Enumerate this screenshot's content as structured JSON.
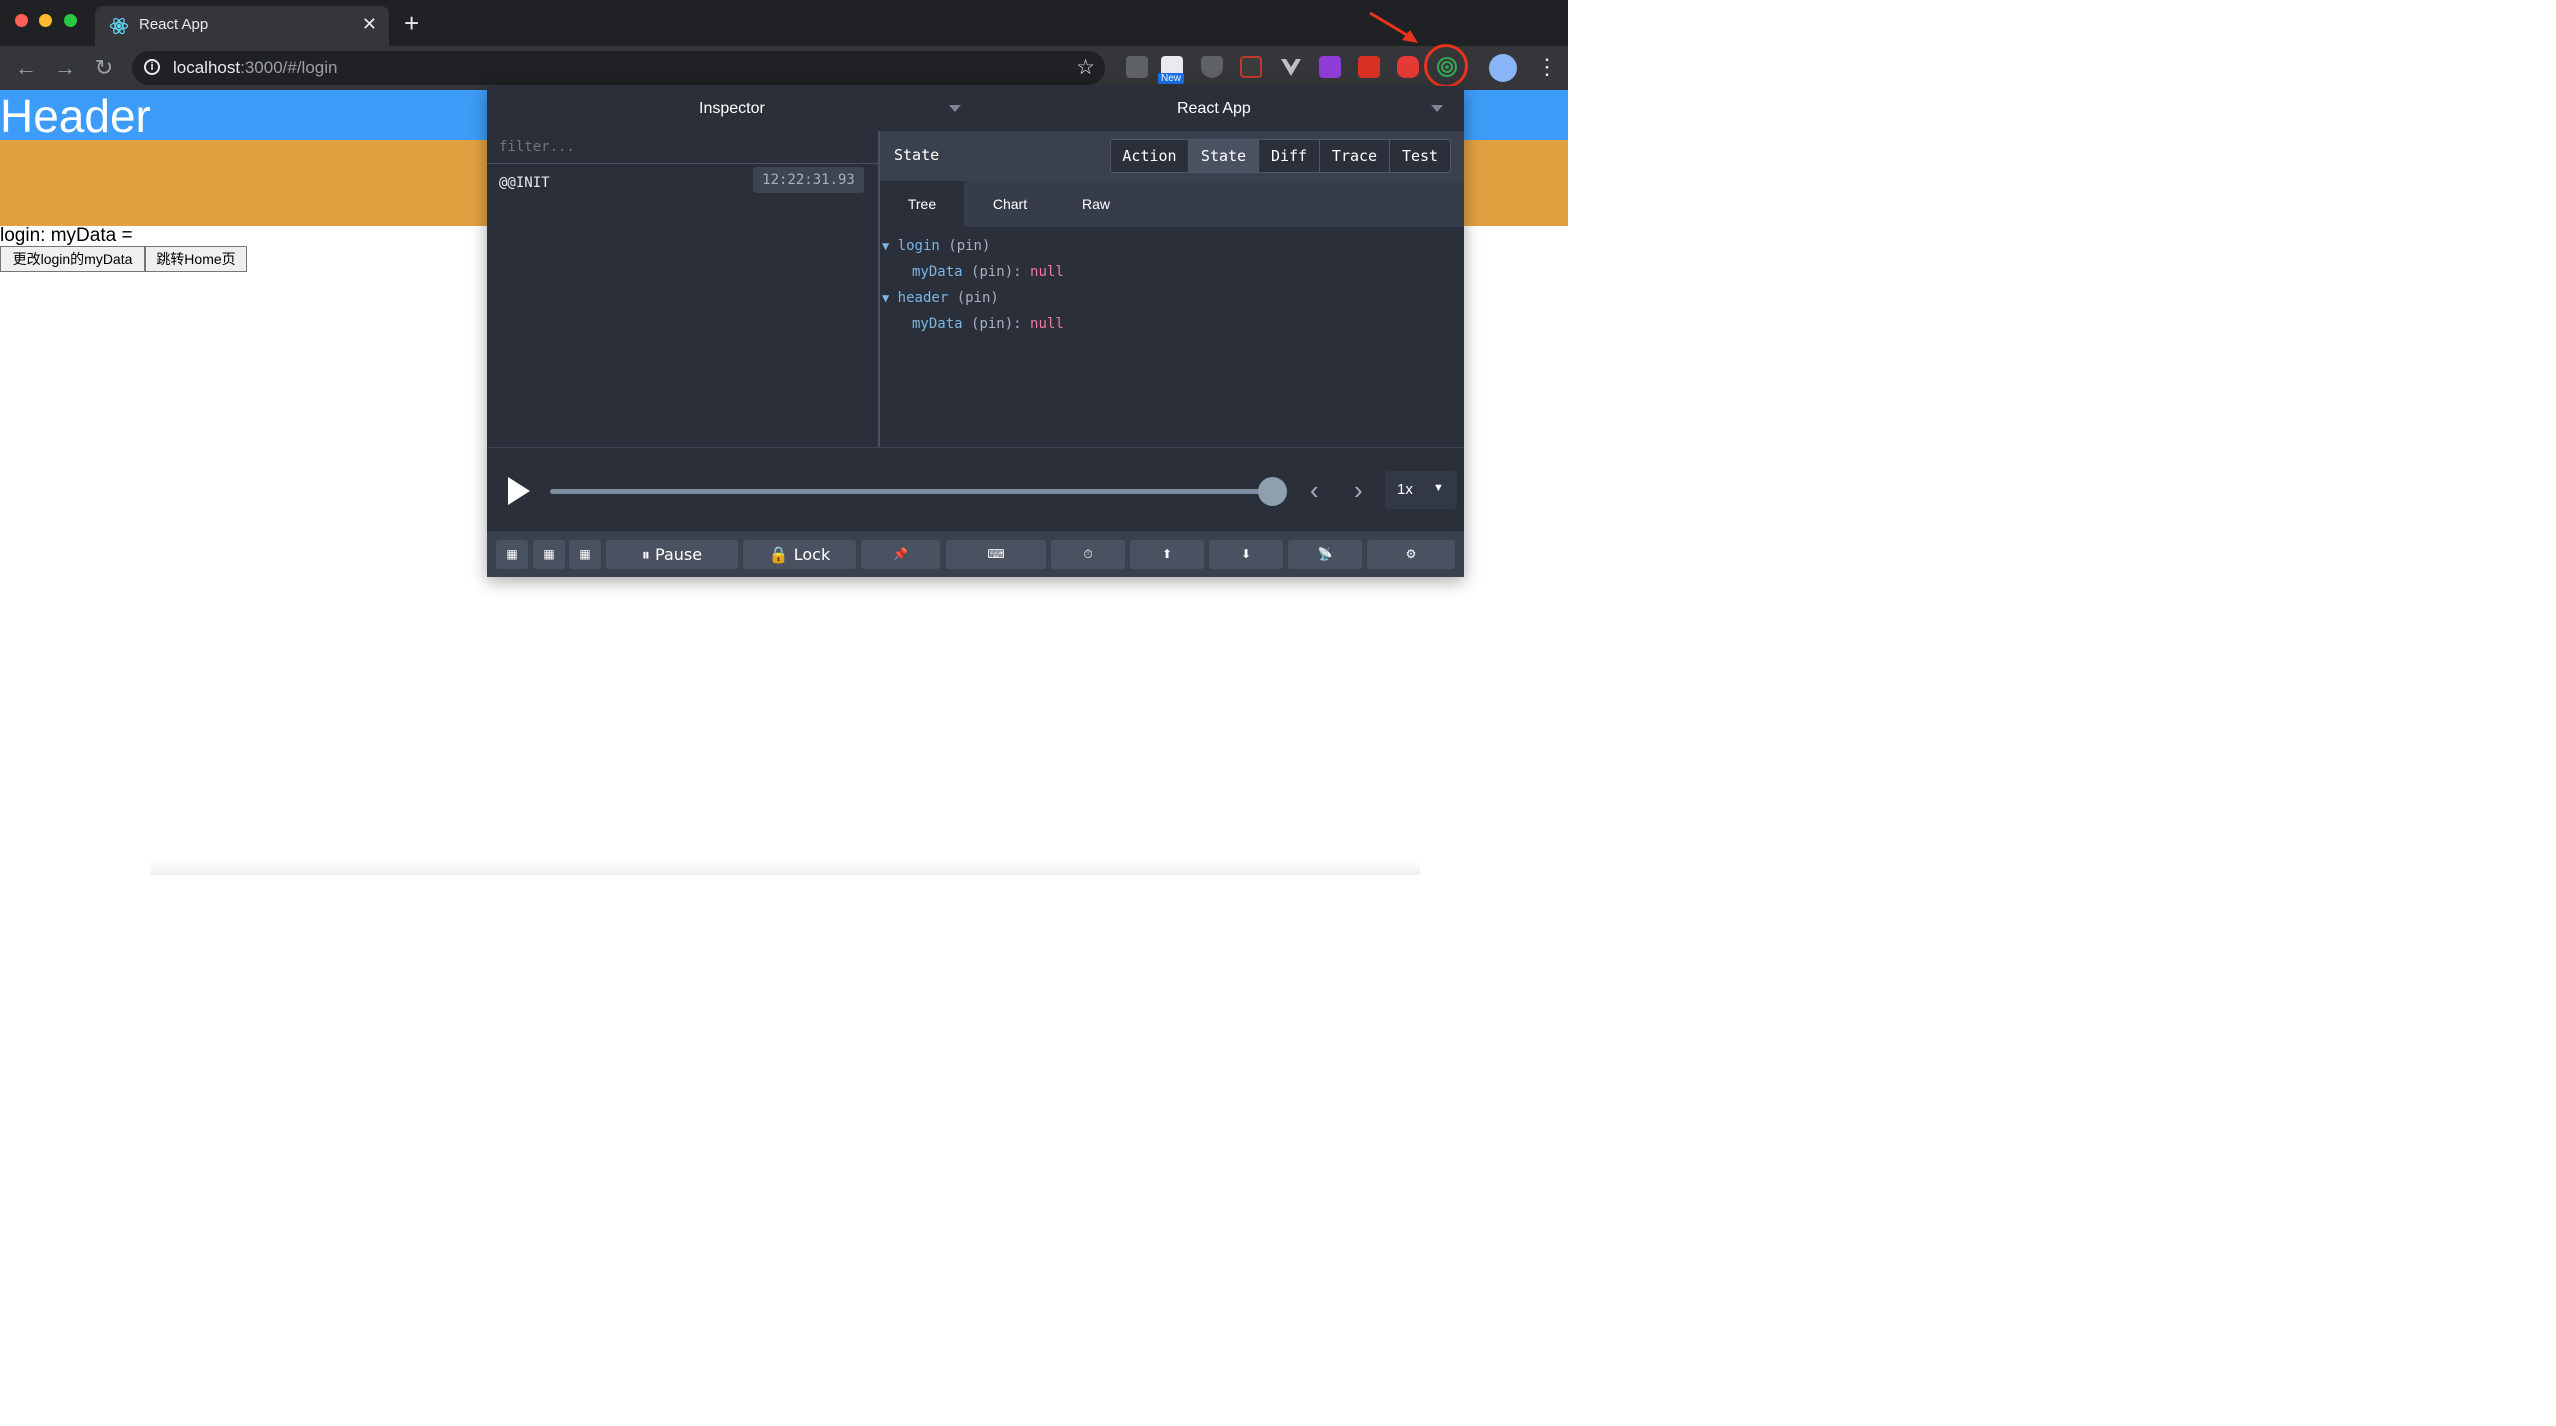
{
  "browser": {
    "tab_title": "React App",
    "tab_close": "✕",
    "new_tab": "+",
    "url_host": "localhost",
    "url_path": ":3000/#/login",
    "nav_back": "←",
    "nav_forward": "→",
    "nav_reload": "↻",
    "star": "☆",
    "ext_new_badge": "New",
    "kebab": "⋮",
    "info": "i"
  },
  "page": {
    "header": "Header",
    "login_line": "login: myData =",
    "buttons": [
      "更改login的myData",
      "跳转Home页"
    ]
  },
  "devtools": {
    "monitor_label": "Inspector",
    "instance_label": "React App",
    "filter_placeholder": "filter...",
    "action": {
      "name": "@@INIT",
      "time": "12:22:31.93"
    },
    "state_title": "State",
    "segments": [
      "Action",
      "State",
      "Diff",
      "Trace",
      "Test"
    ],
    "active_segment": "State",
    "subtabs": [
      "Tree",
      "Chart",
      "Raw"
    ],
    "active_subtab": "Tree",
    "tree": [
      {
        "key": "login",
        "pin": "(pin)",
        "children": [
          {
            "key": "myData",
            "pin": "(pin):",
            "value": "null"
          }
        ]
      },
      {
        "key": "header",
        "pin": "(pin)",
        "children": [
          {
            "key": "myData",
            "pin": "(pin):",
            "value": "null"
          }
        ]
      }
    ],
    "tree_arrow": "▼",
    "slider": {
      "progress": 1.0
    },
    "prev": "‹",
    "next": "›",
    "speed": "1x",
    "speed_caret": "▼",
    "bottom_buttons": {
      "pause": "⏸ Pause",
      "lock": "🔒 Lock",
      "pin": "📌",
      "keyboard": "⌨",
      "clock": "⏱",
      "upload": "⬆",
      "download": "⬇",
      "remote": "📡",
      "settings": "⚙"
    }
  },
  "colors": {
    "header_blue": "#3d9cf7",
    "orange_band": "#e2a140",
    "highlight_ring": "#e8341c"
  }
}
